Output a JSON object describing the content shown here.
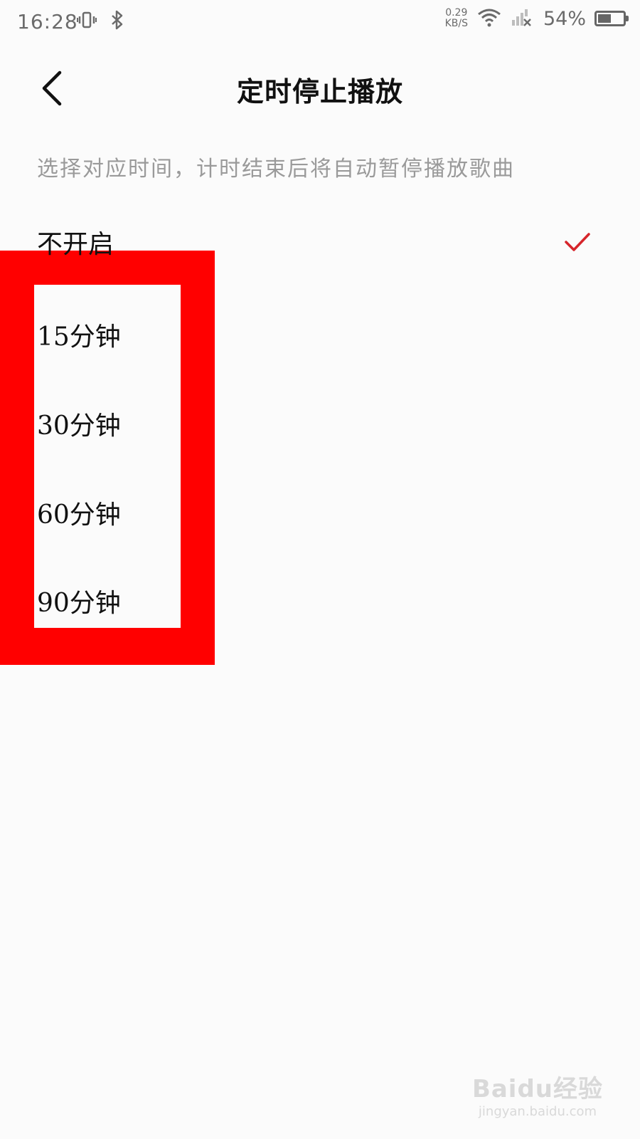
{
  "status_bar": {
    "time": "16:28",
    "net_speed_value": "0.29",
    "net_speed_unit": "KB/S",
    "battery_percent": "54%",
    "battery_level": 0.54,
    "icons": [
      "vibrate-icon",
      "bluetooth-icon",
      "wifi-icon",
      "cellular-signal-icon",
      "battery-icon"
    ]
  },
  "header": {
    "title": "定时停止播放",
    "back_icon": "chevron-left-icon"
  },
  "description": "选择对应时间，计时结束后将自动暂停播放歌曲",
  "options": [
    {
      "label": "不开启",
      "selected": true
    },
    {
      "label": "15分钟",
      "selected": false
    },
    {
      "label": "30分钟",
      "selected": false
    },
    {
      "label": "60分钟",
      "selected": false
    },
    {
      "label": "90分钟",
      "selected": false
    }
  ],
  "colors": {
    "accent": "#d6252b",
    "highlight": "#ff0000",
    "background": "#fbfbfb"
  },
  "watermark": {
    "logo": "Baidu经验",
    "url": "jingyan.baidu.com"
  }
}
